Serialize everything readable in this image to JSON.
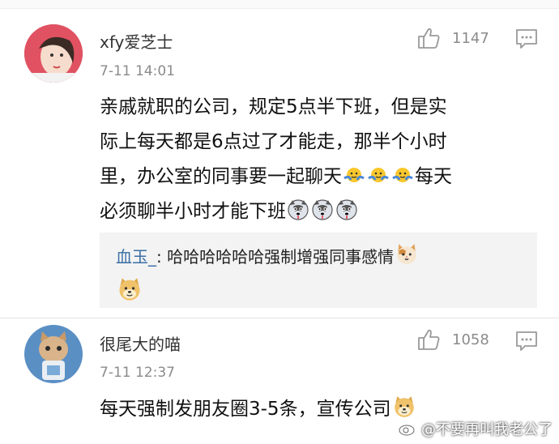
{
  "comments": [
    {
      "username": "xfy爱芝士",
      "time": "7-11 14:01",
      "likes": "1147",
      "lines": [
        "亲戚就职的公司，规定5点半下班，但是实",
        "际上每天都是6点过了才能走，那半个小时",
        "里，办公室的同事要一起聊天",
        "每天",
        "必须聊半小时才能下班"
      ],
      "reply": {
        "user": "血玉_",
        "sep": ": ",
        "text": "哈哈哈哈哈哈强制增强同事感情"
      }
    },
    {
      "username": "很尾大的喵",
      "time": "7-11 12:37",
      "likes": "1058",
      "text": "每天强制发朋友圈3-5条，宣传公司"
    }
  ],
  "watermark": "@不要再叫我老公了",
  "icons": [
    "thumbs-up-icon",
    "comment-icon",
    "hug-emoji-icon",
    "husky-emoji-icon",
    "cat-emoji-icon",
    "doge-emoji-icon",
    "weibo-logo-icon"
  ]
}
